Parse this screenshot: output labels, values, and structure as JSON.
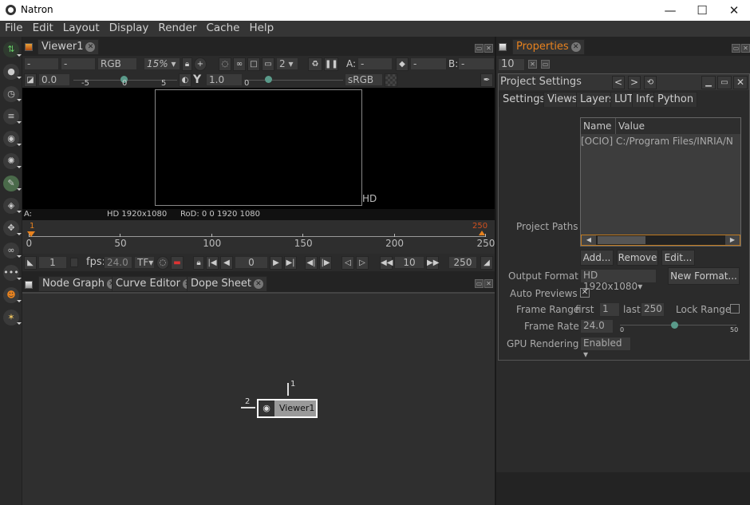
{
  "window": {
    "title": "Natron",
    "minimize": "—",
    "maximize": "☐",
    "close": "✕"
  },
  "menu": [
    "File",
    "Edit",
    "Layout",
    "Display",
    "Render",
    "Cache",
    "Help"
  ],
  "left_toolbar": [
    "image",
    "paint",
    "time",
    "channel",
    "color",
    "filter",
    "transform",
    "merge",
    "keyer",
    "views",
    "other",
    "gmic",
    "extra"
  ],
  "viewer": {
    "tab": "Viewer1",
    "layer": "-",
    "alpha": "-",
    "channels": "RGB",
    "zoom": "15%",
    "proxy": "2",
    "input_a_label": "A:",
    "input_a": "-",
    "input_b": "-",
    "input_b_label": "B:",
    "input_b_val": "-",
    "gain": "0.0",
    "gain_ticks": [
      "-5",
      "0",
      "5"
    ],
    "gain_value": 0,
    "gamma_label": "Y",
    "gamma": "1.0",
    "gamma_ticks": [
      "0"
    ],
    "colorspace": "sRGB",
    "format_overlay": "HD",
    "info_input": "A:",
    "info_format": "HD 1920x1080",
    "info_rod": "RoD: 0 0 1920 1080"
  },
  "timeline": {
    "start_marker": "1",
    "end_marker": "250",
    "ticks": [
      "0",
      "50",
      "100",
      "150",
      "200",
      "250"
    ],
    "range_min": 0,
    "range_max": 250,
    "in_point": "1",
    "fps_label": "fps:",
    "fps": "24.0",
    "tf": "TF",
    "current_frame": "0",
    "increment": "10",
    "out_point": "250"
  },
  "bottom_tabs": [
    "Node Graph",
    "Curve Editor",
    "Dope Sheet"
  ],
  "node": {
    "label": "Viewer1",
    "input1": "1",
    "input2": "2"
  },
  "properties": {
    "tab": "Properties",
    "max_panels": "10",
    "panel_title": "Project Settings",
    "tabs": [
      "Settings",
      "Views",
      "Layers",
      "LUT",
      "Info",
      "Python"
    ],
    "paths_label": "Project Paths",
    "paths_cols": [
      "Name",
      "Value"
    ],
    "paths_rows": [
      [
        "[OCIO]",
        "C:/Program Files/INRIA/N"
      ]
    ],
    "add": "Add...",
    "remove": "Remove",
    "edit": "Edit...",
    "output_format_label": "Output Format",
    "output_format": "HD 1920x1080",
    "new_format": "New Format...",
    "auto_previews_label": "Auto Previews",
    "auto_previews": true,
    "frame_range_label": "Frame Range",
    "first_label": "first",
    "first": "1",
    "last_label": "last",
    "last": "250",
    "lock_range_label": "Lock Range",
    "frame_rate_label": "Frame Rate",
    "frame_rate": "24.0",
    "rate_ticks": [
      "0",
      "50"
    ],
    "gpu_label": "GPU Rendering",
    "gpu": "Enabled"
  },
  "colors": {
    "accent": "#e8821e",
    "bg": "#232323",
    "panel": "#2b2b2b"
  }
}
